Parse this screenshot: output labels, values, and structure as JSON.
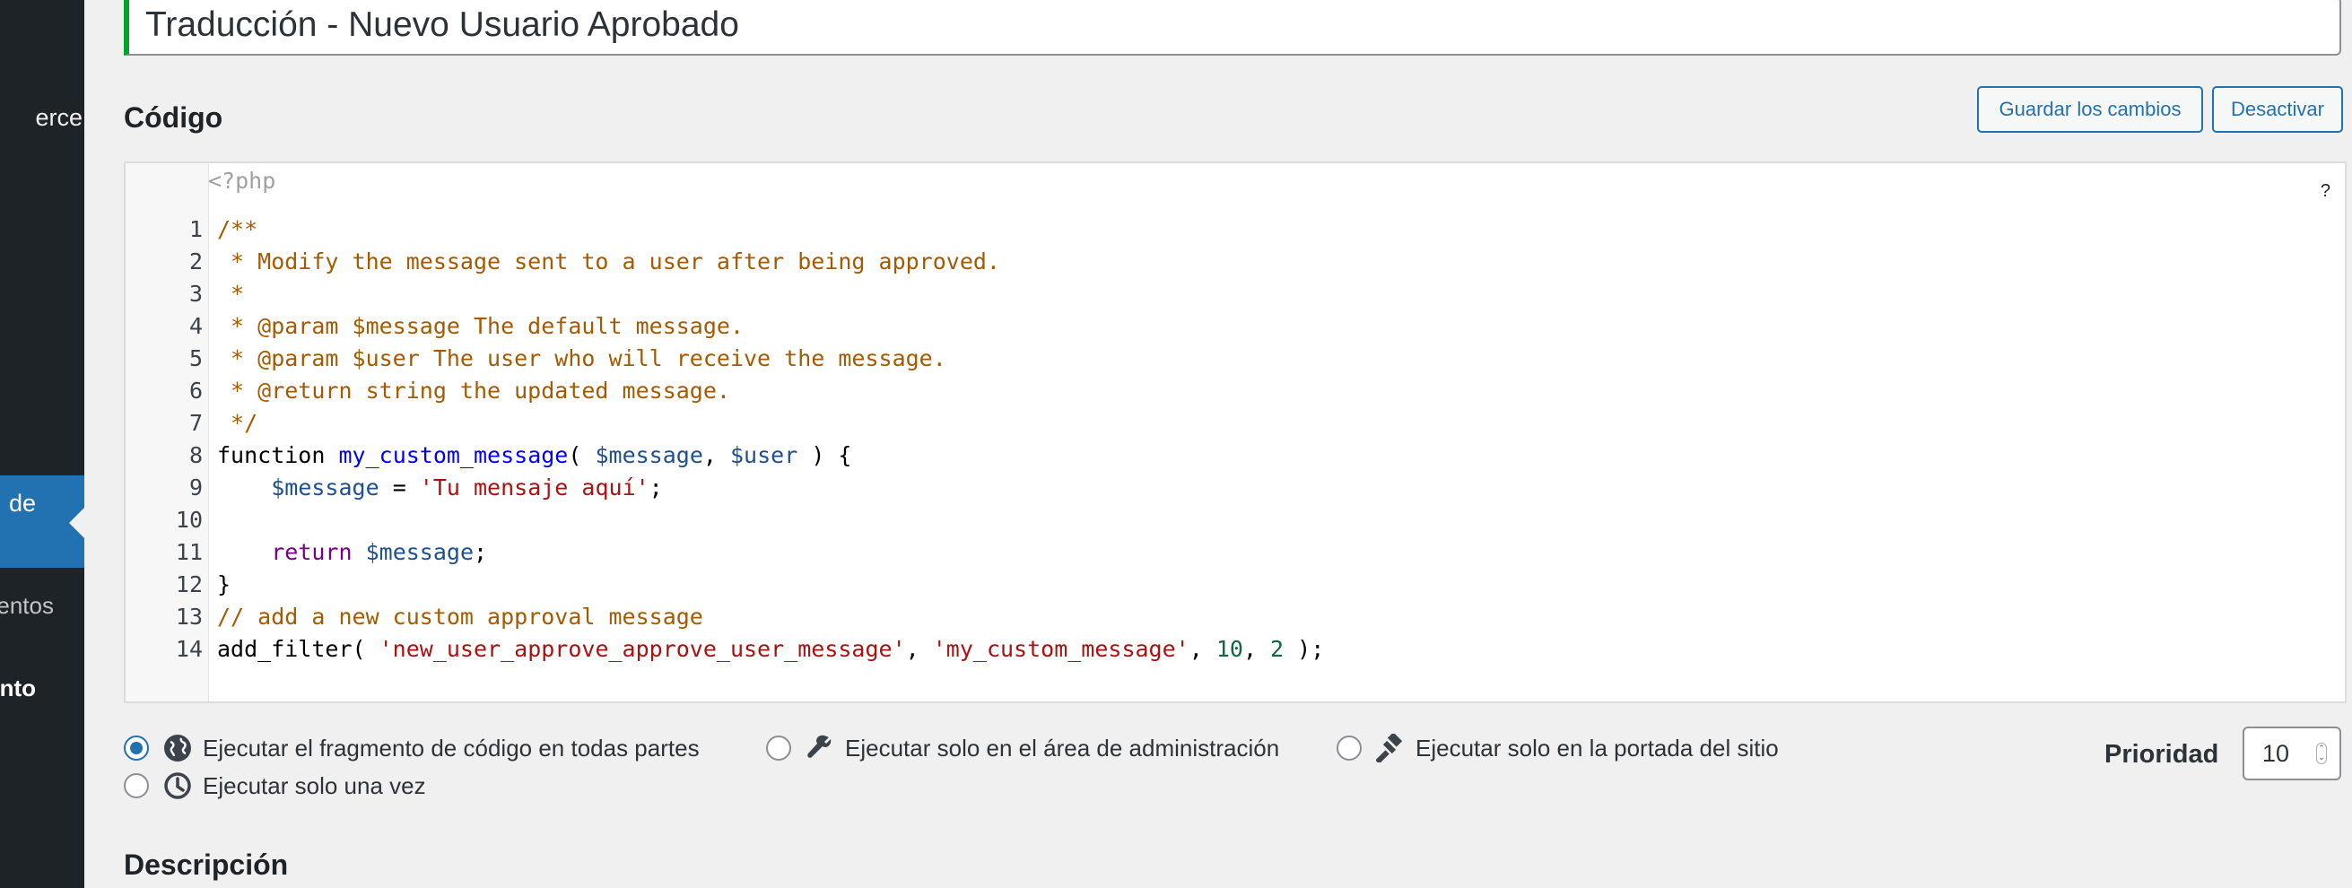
{
  "sidebar": {
    "items": [
      {
        "label": "erce"
      },
      {
        "label": "de",
        "active": true
      },
      {
        "label": "entos"
      },
      {
        "label": "nto"
      }
    ]
  },
  "snippet": {
    "title_value": "Traducción - Nuevo Usuario Aprobado"
  },
  "code_section": {
    "heading": "Código",
    "save_label": "Guardar los cambios",
    "deactivate_label": "Desactivar",
    "help_label": "?",
    "php_open": "<?php",
    "line_numbers": [
      "1",
      "2",
      "3",
      "4",
      "5",
      "6",
      "7",
      "8",
      "9",
      "10",
      "11",
      "12",
      "13",
      "14"
    ],
    "lines": [
      "/**",
      " * Modify the message sent to a user after being approved.",
      " *",
      " * @param $message The default message.",
      " * @param $user The user who will receive the message.",
      " * @return string the updated message.",
      " */",
      "function my_custom_message( $message, $user ) {",
      "    $message = 'Tu mensaje aquí';",
      "",
      "    return $message;",
      "}",
      "// add a new custom approval message",
      "add_filter( 'new_user_approve_approve_user_message', 'my_custom_message', 10, 2 );"
    ]
  },
  "run_options": [
    {
      "label": "Ejecutar el fragmento de código en todas partes",
      "icon": "globe-icon",
      "checked": true
    },
    {
      "label": "Ejecutar solo en el área de administración",
      "icon": "wrench-icon",
      "checked": false
    },
    {
      "label": "Ejecutar solo en la portada del sitio",
      "icon": "hammer-icon",
      "checked": false
    },
    {
      "label": "Ejecutar solo una vez",
      "icon": "clock-icon",
      "checked": false
    }
  ],
  "priority": {
    "label": "Prioridad",
    "value": "10"
  },
  "description": {
    "heading": "Descripción"
  },
  "colors": {
    "accent": "#2271b1",
    "active_border": "#00a32a",
    "sidebar_bg": "#1d2327",
    "comment": "#a55a00",
    "string": "#aa1111",
    "variable": "#1d4f91"
  }
}
